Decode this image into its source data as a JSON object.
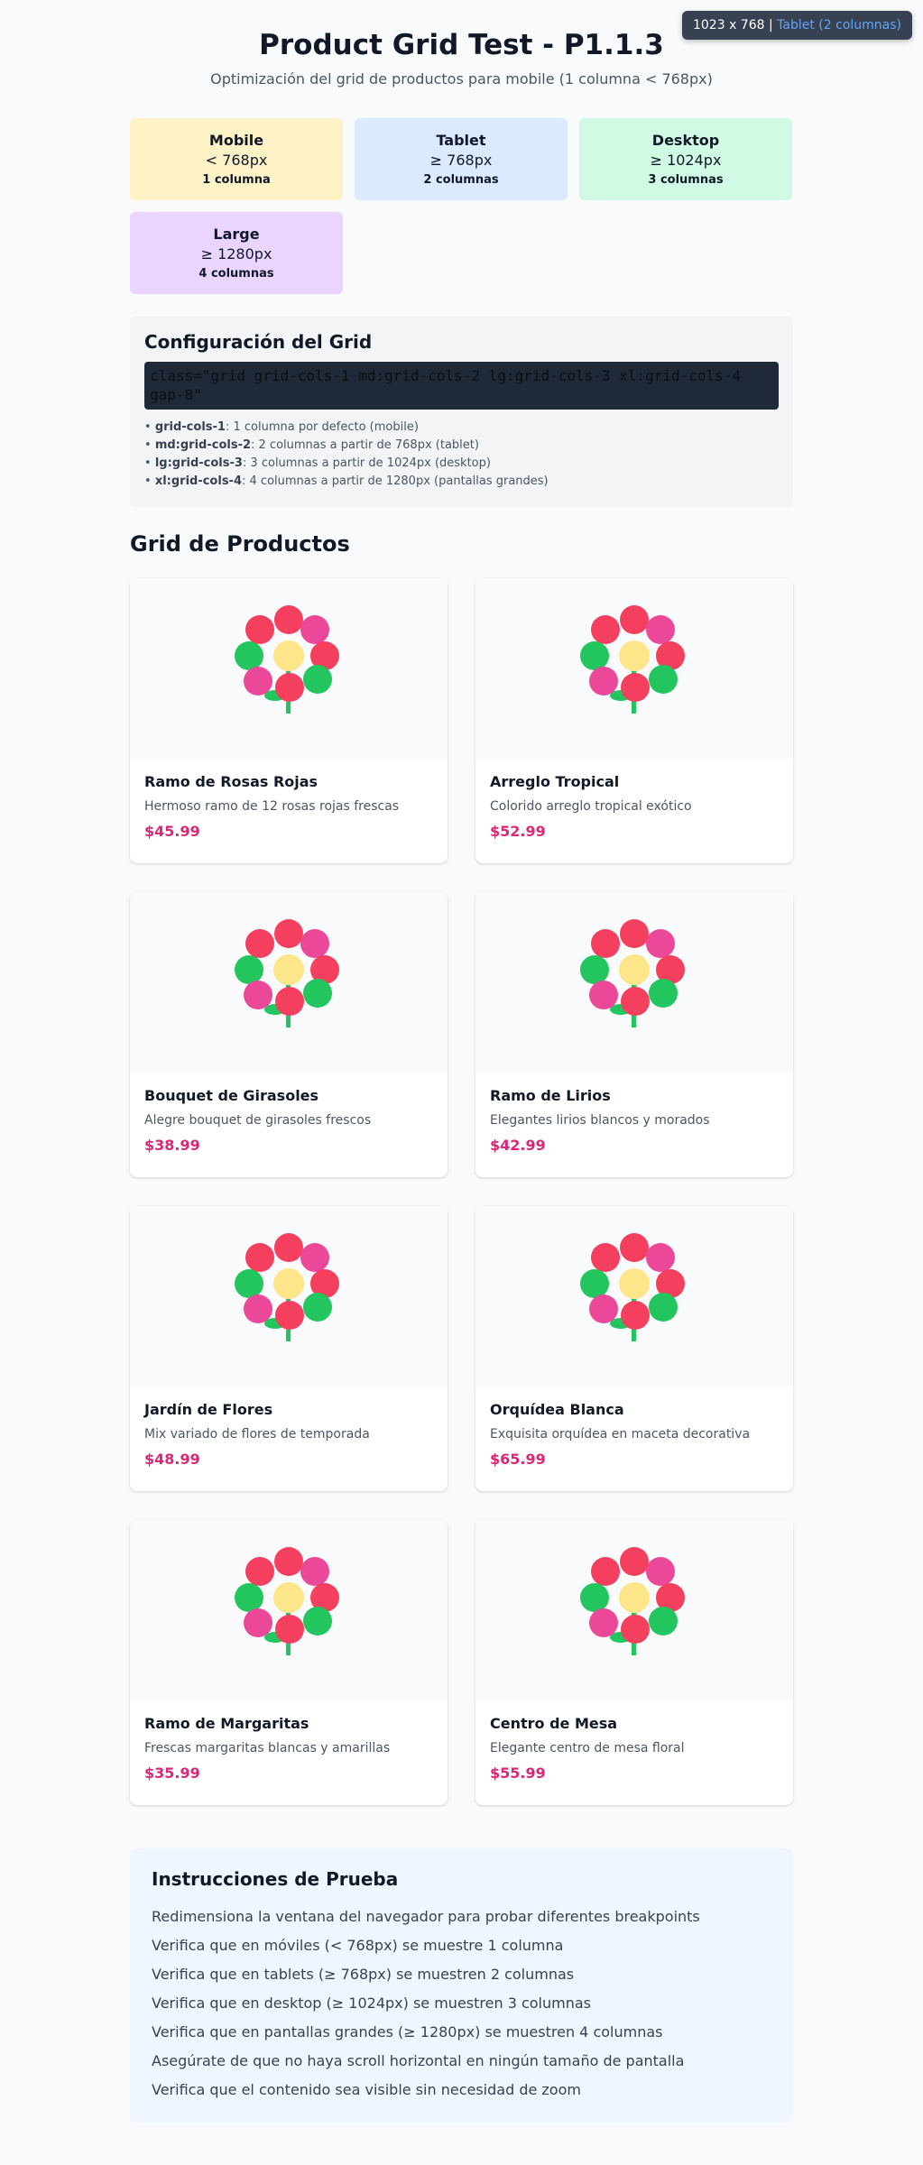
{
  "viewport_badge": {
    "size": "1023 x 768",
    "separator": "|",
    "breakpoint": "Tablet (2 columnas)"
  },
  "header": {
    "title": "Product Grid Test - P1.1.3",
    "subtitle": "Optimización del grid de productos para mobile (1 columna < 768px)"
  },
  "breakpoints": [
    {
      "name": "Mobile",
      "range": "< 768px",
      "columns": "1 columna",
      "color": "#fef3c7"
    },
    {
      "name": "Tablet",
      "range": "≥ 768px",
      "columns": "2 columnas",
      "color": "#dbeafe"
    },
    {
      "name": "Desktop",
      "range": "≥ 1024px",
      "columns": "3 columnas",
      "color": "#d1fae5"
    },
    {
      "name": "Large",
      "range": "≥ 1280px",
      "columns": "4 columnas",
      "color": "#e9d5ff"
    }
  ],
  "config": {
    "title": "Configuración del Grid",
    "code": "class=\"grid grid-cols-1 md:grid-cols-2 lg:grid-cols-3 xl:grid-cols-4 gap-8\"",
    "items": [
      {
        "key": "grid-cols-1",
        "text": ": 1 columna por defecto (mobile)"
      },
      {
        "key": "md:grid-cols-2",
        "text": ": 2 columnas a partir de 768px (tablet)"
      },
      {
        "key": "lg:grid-cols-3",
        "text": ": 3 columnas a partir de 1024px (desktop)"
      },
      {
        "key": "xl:grid-cols-4",
        "text": ": 4 columnas a partir de 1280px (pantallas grandes)"
      }
    ]
  },
  "products_section": {
    "title": "Grid de Productos",
    "image_icon": "flower-icon",
    "products": [
      {
        "name": "Ramo de Rosas Rojas",
        "description": "Hermoso ramo de 12 rosas rojas frescas",
        "price": "$45.99"
      },
      {
        "name": "Arreglo Tropical",
        "description": "Colorido arreglo tropical exótico",
        "price": "$52.99"
      },
      {
        "name": "Bouquet de Girasoles",
        "description": "Alegre bouquet de girasoles frescos",
        "price": "$38.99"
      },
      {
        "name": "Ramo de Lirios",
        "description": "Elegantes lirios blancos y morados",
        "price": "$42.99"
      },
      {
        "name": "Jardín de Flores",
        "description": "Mix variado de flores de temporada",
        "price": "$48.99"
      },
      {
        "name": "Orquídea Blanca",
        "description": "Exquisita orquídea en maceta decorativa",
        "price": "$65.99"
      },
      {
        "name": "Ramo de Margaritas",
        "description": "Frescas margaritas blancas y amarillas",
        "price": "$35.99"
      },
      {
        "name": "Centro de Mesa",
        "description": "Elegante centro de mesa floral",
        "price": "$55.99"
      }
    ]
  },
  "instructions": {
    "title": "Instrucciones de Prueba",
    "items": [
      "Redimensiona la ventana del navegador para probar diferentes breakpoints",
      "Verifica que en móviles (< 768px) se muestre 1 columna",
      "Verifica que en tablets (≥ 768px) se muestren 2 columnas",
      "Verifica que en desktop (≥ 1024px) se muestren 3 columnas",
      "Verifica que en pantallas grandes (≥ 1280px) se muestren 4 columnas",
      "Asegúrate de que no haya scroll horizontal en ningún tamaño de pantalla",
      "Verifica que el contenido sea visible sin necesidad de zoom"
    ]
  },
  "colors": {
    "petal_red": "#f43f5e",
    "petal_pink": "#ec4899",
    "petal_green": "#22c55e",
    "center_yellow": "#fde68a",
    "stem_green": "#22c55e",
    "price_pink": "#db2777"
  }
}
